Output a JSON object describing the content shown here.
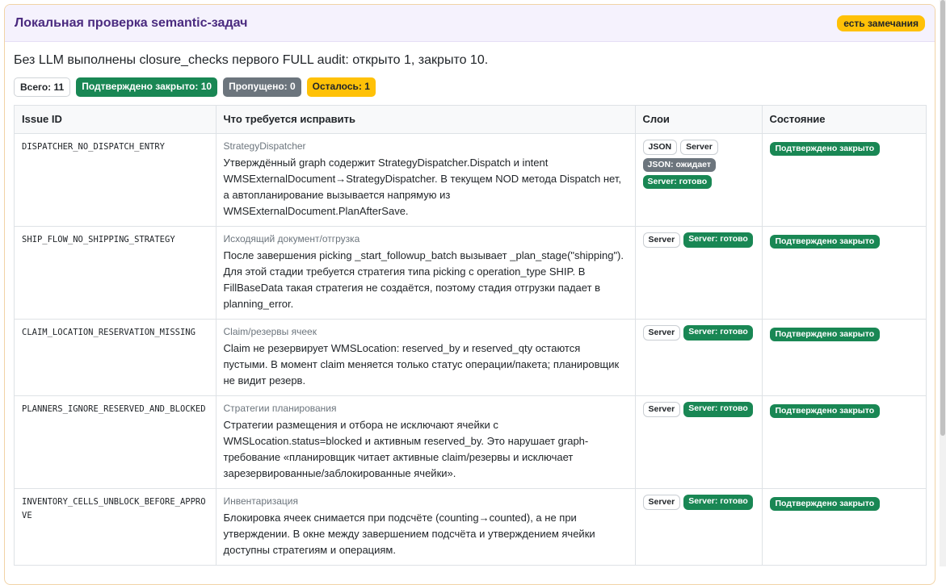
{
  "header": {
    "title": "Локальная проверка semantic-задач",
    "status_badge": "есть замечания"
  },
  "summary": "Без LLM выполнены closure_checks первого FULL audit: открыто 1, закрыто 10.",
  "stats": {
    "total": "Всего: 11",
    "closed": "Подтверждено закрыто: 10",
    "skipped": "Пропущено: 0",
    "left": "Осталось: 1"
  },
  "table": {
    "headers": {
      "id": "Issue ID",
      "fix": "Что требуется исправить",
      "layers": "Слои",
      "state": "Состояние"
    },
    "rows": [
      {
        "id": "DISPATCHER_NO_DISPATCH_ENTRY",
        "area": "StrategyDispatcher",
        "text": "Утверждённый graph содержит StrategyDispatcher.Dispatch и intent WMSExternalDocument→StrategyDispatcher. В текущем NOD метода Dispatch нет, а автопланирование вызывается напрямую из WMSExternalDocument.PlanAfterSave.",
        "layers": [
          "JSON",
          "Server"
        ],
        "layer_status": [
          "JSON: ожидает",
          "Server: готово"
        ],
        "state": "Подтверждено закрыто"
      },
      {
        "id": "SHIP_FLOW_NO_SHIPPING_STRATEGY",
        "area": "Исходящий документ/отгрузка",
        "text": "После завершения picking _start_followup_batch вызывает _plan_stage(\"shipping\"). Для этой стадии требуется стратегия типа picking с operation_type SHIP. В FillBaseData такая стратегия не создаётся, поэтому стадия отгрузки падает в planning_error.",
        "layers": [
          "Server"
        ],
        "layer_status": [
          "Server: готово"
        ],
        "state": "Подтверждено закрыто"
      },
      {
        "id": "CLAIM_LOCATION_RESERVATION_MISSING",
        "area": "Claim/резервы ячеек",
        "text": "Claim не резервирует WMSLocation: reserved_by и reserved_qty остаются пустыми. В момент claim меняется только статус операции/пакета; планировщик не видит резерв.",
        "layers": [
          "Server"
        ],
        "layer_status": [
          "Server: готово"
        ],
        "state": "Подтверждено закрыто"
      },
      {
        "id": "PLANNERS_IGNORE_RESERVED_AND_BLOCKED",
        "area": "Стратегии планирования",
        "text": "Стратегии размещения и отбора не исключают ячейки с WMSLocation.status=blocked и активным reserved_by. Это нарушает graph-требование «планировщик читает активные claim/резервы и исключает зарезервированные/заблокированные ячейки».",
        "layers": [
          "Server"
        ],
        "layer_status": [
          "Server: готово"
        ],
        "state": "Подтверждено закрыто"
      },
      {
        "id": "INVENTORY_CELLS_UNBLOCK_BEFORE_APPROVE",
        "area": "Инвентаризация",
        "text": "Блокировка ячеек снимается при подсчёте (counting→counted), а не при утверждении. В окне между завершением подсчёта и утверждением ячейки доступны стратегиям и операциям.",
        "layers": [
          "Server"
        ],
        "layer_status": [
          "Server: готово"
        ],
        "state": "Подтверждено закрыто"
      }
    ]
  }
}
